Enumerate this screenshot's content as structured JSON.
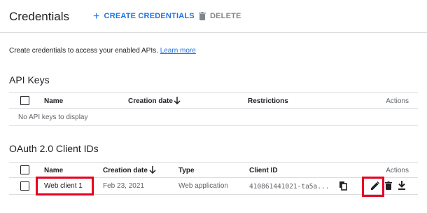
{
  "header": {
    "title": "Credentials",
    "create_label": "CREATE CREDENTIALS",
    "delete_label": "DELETE"
  },
  "intro": {
    "text": "Create credentials to access your enabled APIs.",
    "link": "Learn more"
  },
  "api_keys": {
    "title": "API Keys",
    "columns": {
      "name": "Name",
      "created": "Creation date",
      "restrictions": "Restrictions",
      "actions": "Actions"
    },
    "empty_text": "No API keys to display"
  },
  "oauth": {
    "title": "OAuth 2.0 Client IDs",
    "columns": {
      "name": "Name",
      "created": "Creation date",
      "type": "Type",
      "client_id": "Client ID",
      "actions": "Actions"
    },
    "rows": [
      {
        "name": "Web client 1",
        "created": "Feb 23, 2021",
        "type": "Web application",
        "client_id": "410861441021-ta5a..."
      }
    ]
  },
  "colors": {
    "accent": "#1a73e8",
    "highlight": "#e8001f"
  }
}
